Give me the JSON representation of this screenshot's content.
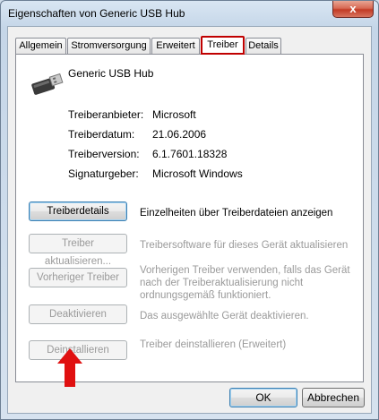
{
  "window": {
    "title": "Eigenschaften von Generic USB Hub",
    "close_label": "x"
  },
  "tabs": [
    {
      "label": "Allgemein"
    },
    {
      "label": "Stromversorgung"
    },
    {
      "label": "Erweitert"
    },
    {
      "label": "Treiber",
      "active": true
    },
    {
      "label": "Details"
    }
  ],
  "device": {
    "name": "Generic USB Hub",
    "icon": "usb-plug-icon"
  },
  "properties": [
    {
      "label": "Treiberanbieter:",
      "value": "Microsoft"
    },
    {
      "label": "Treiberdatum:",
      "value": "21.06.2006"
    },
    {
      "label": "Treiberversion:",
      "value": "6.1.7601.18328"
    },
    {
      "label": "Signaturgeber:",
      "value": "Microsoft Windows"
    }
  ],
  "actions": [
    {
      "button": "Treiberdetails",
      "description": "Einzelheiten über Treiberdateien anzeigen",
      "enabled": true
    },
    {
      "button": "Treiber aktualisieren...",
      "description": "Treibersoftware für dieses Gerät aktualisieren",
      "enabled": false
    },
    {
      "button": "Vorheriger Treiber",
      "description": "Vorherigen Treiber verwenden, falls das Gerät nach der Treiberaktualisierung nicht ordnungsgemäß funktioniert.",
      "enabled": false
    },
    {
      "button": "Deaktivieren",
      "description": "Das ausgewählte Gerät deaktivieren.",
      "enabled": false
    },
    {
      "button": "Deinstallieren",
      "description": "Treiber deinstallieren (Erweitert)",
      "enabled": false
    }
  ],
  "footer": {
    "ok_label": "OK",
    "cancel_label": "Abbrechen"
  },
  "colors": {
    "highlight": "#c00000",
    "arrow": "#e01010"
  }
}
